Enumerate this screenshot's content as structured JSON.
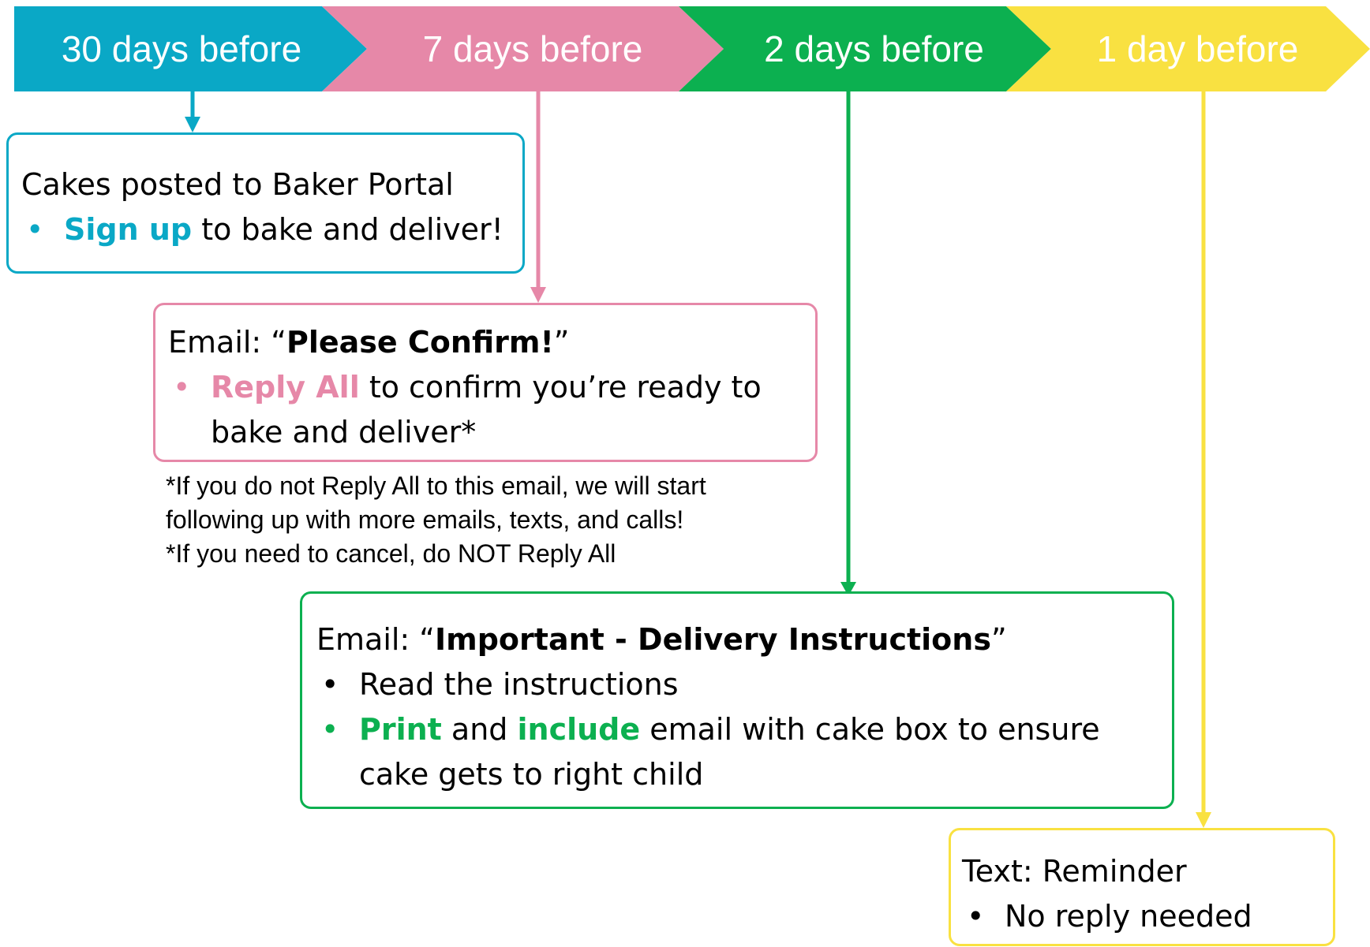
{
  "colors": {
    "teal": "#0AA8C6",
    "pink": "#E688A8",
    "green": "#0CB050",
    "yellow": "#F9E141"
  },
  "stages": [
    {
      "label": "30 days before",
      "color": "#0AA8C6"
    },
    {
      "label": "7 days before",
      "color": "#E688A8"
    },
    {
      "label": "2 days before",
      "color": "#0CB050"
    },
    {
      "label": "1 day before",
      "color": "#F9E141"
    }
  ],
  "boxes": {
    "portal": {
      "heading": "Cakes posted to Baker Portal",
      "bullet_highlight": "Sign up",
      "bullet_text": " to bake and deliver!"
    },
    "confirm": {
      "heading_prefix": "Email: “",
      "heading_bold": "Please Confirm!",
      "heading_suffix": "”",
      "bullet_highlight": "Reply All",
      "bullet_text": " to confirm you’re ready to bake and deliver*"
    },
    "delivery": {
      "heading_prefix": "Email: “",
      "heading_bold": "Important - Delivery Instructions",
      "heading_suffix": "”",
      "bullet1": "Read the instructions",
      "bullet2_highlight1": "Print",
      "bullet2_mid": " and ",
      "bullet2_highlight2": "include",
      "bullet2_text": " email with cake box to ensure cake gets to right child"
    },
    "reminder": {
      "heading": "Text: Reminder",
      "bullet": "No reply needed"
    }
  },
  "note": [
    "*If you do not Reply All to this email, we will start",
    "following up with more emails, texts, and calls!",
    "*If you need to cancel, do NOT Reply All"
  ],
  "bullet_char": "•"
}
